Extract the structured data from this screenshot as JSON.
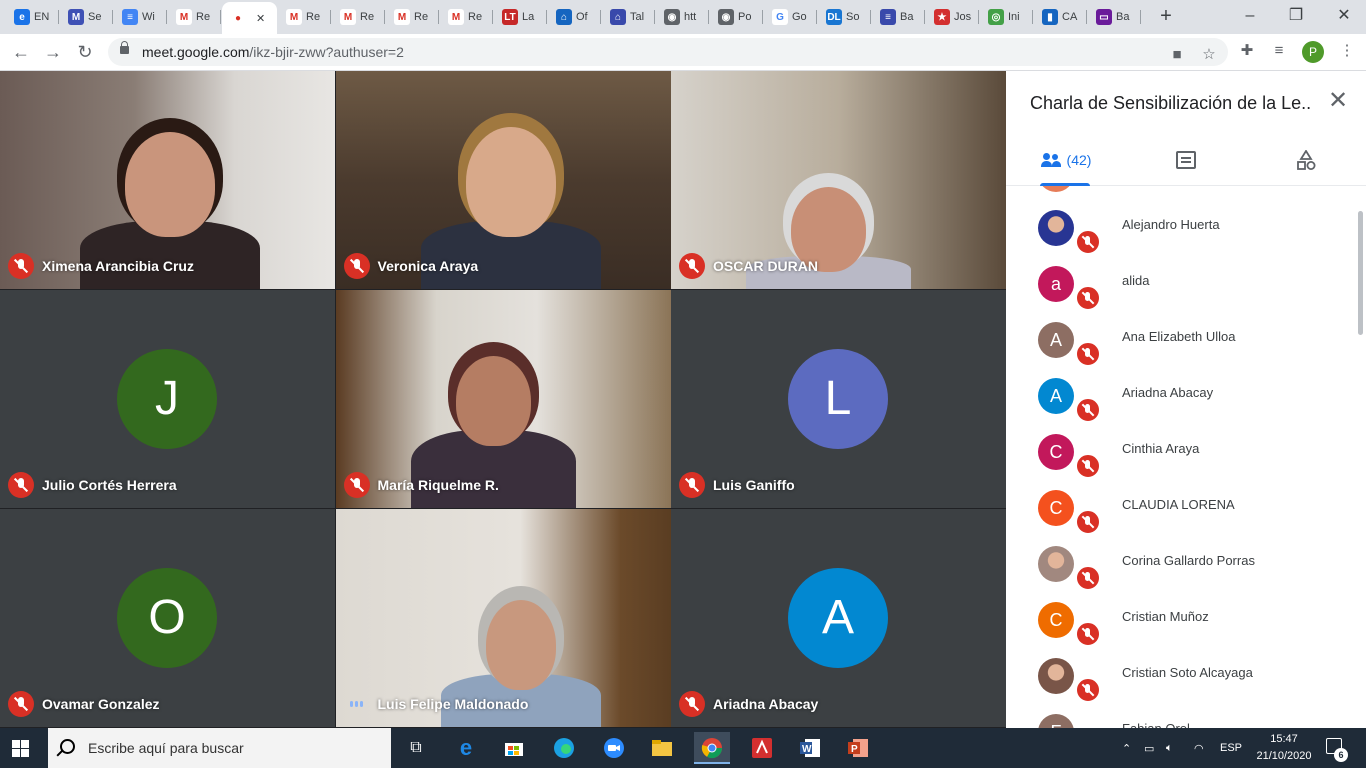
{
  "browser": {
    "tabs": [
      {
        "label": "EN",
        "fav_color": "#1a73e8",
        "fav_char": "e"
      },
      {
        "label": "Se",
        "fav_color": "#3f51b5",
        "fav_char": "M"
      },
      {
        "label": "Wi",
        "fav_color": "#4285f4",
        "fav_char": "≡"
      },
      {
        "label": "Re",
        "fav_color": "#ffffff",
        "fav_char": "M"
      },
      {
        "label": "",
        "fav_color": "#ffffff",
        "fav_char": "●",
        "active": true
      },
      {
        "label": "Re",
        "fav_color": "#ffffff",
        "fav_char": "M"
      },
      {
        "label": "Re",
        "fav_color": "#ffffff",
        "fav_char": "M"
      },
      {
        "label": "Re",
        "fav_color": "#ffffff",
        "fav_char": "M"
      },
      {
        "label": "Re",
        "fav_color": "#ffffff",
        "fav_char": "M"
      },
      {
        "label": "La",
        "fav_color": "#c62828",
        "fav_char": "LT"
      },
      {
        "label": "Of",
        "fav_color": "#1565c0",
        "fav_char": "⌂"
      },
      {
        "label": "Tal",
        "fav_color": "#3949ab",
        "fav_char": "⌂"
      },
      {
        "label": "htt",
        "fav_color": "#5f6368",
        "fav_char": "◉"
      },
      {
        "label": "Po",
        "fav_color": "#5f6368",
        "fav_char": "◉"
      },
      {
        "label": "Go",
        "fav_color": "#ffffff",
        "fav_char": "G"
      },
      {
        "label": "So",
        "fav_color": "#1976d2",
        "fav_char": "DL"
      },
      {
        "label": "Ba",
        "fav_color": "#3949ab",
        "fav_char": "≡"
      },
      {
        "label": "Jos",
        "fav_color": "#d32f2f",
        "fav_char": "★"
      },
      {
        "label": "Ini",
        "fav_color": "#43a047",
        "fav_char": "◎"
      },
      {
        "label": "CA",
        "fav_color": "#1565c0",
        "fav_char": "▮"
      },
      {
        "label": "Ba",
        "fav_color": "#6a1b9a",
        "fav_char": "▭"
      }
    ],
    "url_host": "meet.google.com",
    "url_path": "/ikz-bjir-zww?authuser=2",
    "profile_initial": "P"
  },
  "meet": {
    "tiles": [
      {
        "name": "Ximena Arancibia Cruz",
        "type": "video",
        "mic": "off"
      },
      {
        "name": "Veronica Araya",
        "type": "video",
        "mic": "off"
      },
      {
        "name": "OSCAR DURAN",
        "type": "video",
        "mic": "off"
      },
      {
        "name": "Julio Cortés Herrera",
        "type": "avatar",
        "initial": "J",
        "color": "#33691e",
        "mic": "off"
      },
      {
        "name": "María Riquelme R.",
        "type": "video",
        "mic": "off"
      },
      {
        "name": "Luis Ganiffo",
        "type": "avatar",
        "initial": "L",
        "color": "#5c6bc0",
        "mic": "off"
      },
      {
        "name": "Ovamar Gonzalez",
        "type": "avatar",
        "initial": "O",
        "color": "#33691e",
        "mic": "off"
      },
      {
        "name": "Luis Felipe Maldonado",
        "type": "video",
        "mic": "on"
      },
      {
        "name": "Ariadna Abacay",
        "type": "avatar",
        "initial": "A",
        "color": "#0288d1",
        "mic": "off"
      }
    ]
  },
  "panel": {
    "title": "Charla de Sensibilización de la Le...",
    "people_count": "(42)",
    "participants": [
      {
        "name": "Alejandro Huerta",
        "initial": "",
        "color": "#283593",
        "photo": true
      },
      {
        "name": "alida",
        "initial": "a",
        "color": "#c2185b"
      },
      {
        "name": "Ana Elizabeth Ulloa",
        "initial": "A",
        "color": "#8d6e63"
      },
      {
        "name": "Ariadna Abacay",
        "initial": "A",
        "color": "#0288d1"
      },
      {
        "name": "Cinthia Araya",
        "initial": "C",
        "color": "#c2185b"
      },
      {
        "name": "CLAUDIA LORENA",
        "initial": "C",
        "color": "#f4511e"
      },
      {
        "name": "Corina Gallardo Porras",
        "initial": "",
        "color": "#a1887f",
        "photo": true
      },
      {
        "name": "Cristian Muñoz",
        "initial": "C",
        "color": "#ef6c00"
      },
      {
        "name": "Cristian Soto Alcayaga",
        "initial": "",
        "color": "#795548",
        "photo": true
      },
      {
        "name": "Fabian Orel...",
        "initial": "F",
        "color": "#8d6e63"
      }
    ]
  },
  "taskbar": {
    "search_placeholder": "Escribe aquí para buscar",
    "lang": "ESP",
    "time": "15:47",
    "date": "21/10/2020",
    "notif_count": "6"
  }
}
